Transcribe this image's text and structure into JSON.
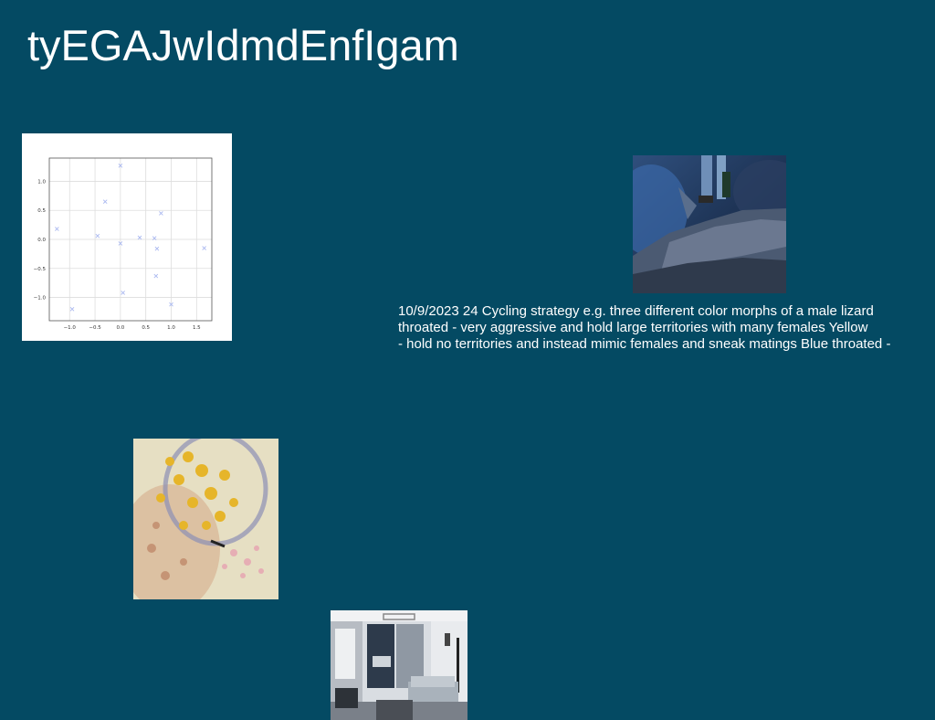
{
  "page": {
    "title": "tyEGAJwIdmdEnfIgam",
    "background": "#044a63"
  },
  "images": {
    "scatter": {
      "kind": "scatter-plot-image"
    },
    "lizard": {
      "kind": "photo-person-on-log"
    },
    "painting": {
      "kind": "abstract-floral-painting"
    },
    "room": {
      "kind": "interior-room-photo"
    }
  },
  "caption": {
    "lines": [
      "10/9/2023 24 Cycling strategy e.g. three different color morphs of a male lizard",
      "throated - very aggressive and hold large territories with many females Yellow",
      "- hold no territories and instead mimic females and sneak matings Blue throated -"
    ]
  },
  "chart_data": {
    "type": "scatter",
    "x": [
      -1.25,
      -0.95,
      -0.45,
      -0.3,
      0.0,
      0.0,
      0.05,
      0.38,
      0.67,
      0.7,
      0.72,
      0.8,
      1.0,
      1.65
    ],
    "y": [
      0.18,
      -1.2,
      0.06,
      0.65,
      1.27,
      -0.07,
      -0.92,
      0.03,
      0.02,
      -0.63,
      -0.16,
      0.45,
      -1.12,
      -0.15
    ],
    "xticks": [
      "−1.0",
      "−0.5",
      "0.0",
      "0.5",
      "1.0",
      "1.5"
    ],
    "yticks": [
      "1.0",
      "0.5",
      "0.0",
      "−0.5",
      "−1.0"
    ],
    "xlim": [
      -1.4,
      1.8
    ],
    "ylim": [
      -1.4,
      1.4
    ],
    "grid": true,
    "marker_color": "#aab8f0"
  }
}
